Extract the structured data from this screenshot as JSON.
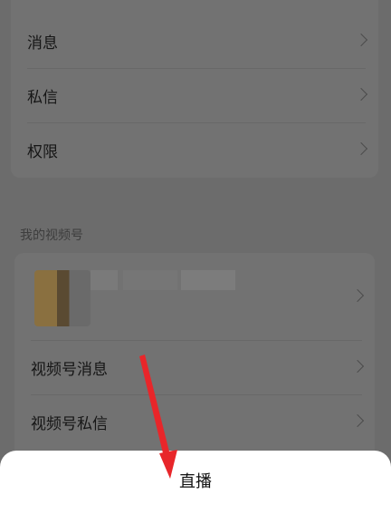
{
  "settings_list": {
    "items": [
      {
        "label": "消息"
      },
      {
        "label": "私信"
      },
      {
        "label": "权限"
      }
    ]
  },
  "video_account": {
    "section_title": "我的视频号",
    "items": [
      {
        "label": "视频号消息"
      },
      {
        "label": "视频号私信"
      }
    ]
  },
  "action_sheet": {
    "option_label": "直播"
  },
  "colors": {
    "overlay": "#6c6c6c",
    "sheet": "#ffffff",
    "annotation_arrow": "#e8262a"
  },
  "icons": {
    "row_chevron": "chevron-right-icon"
  }
}
